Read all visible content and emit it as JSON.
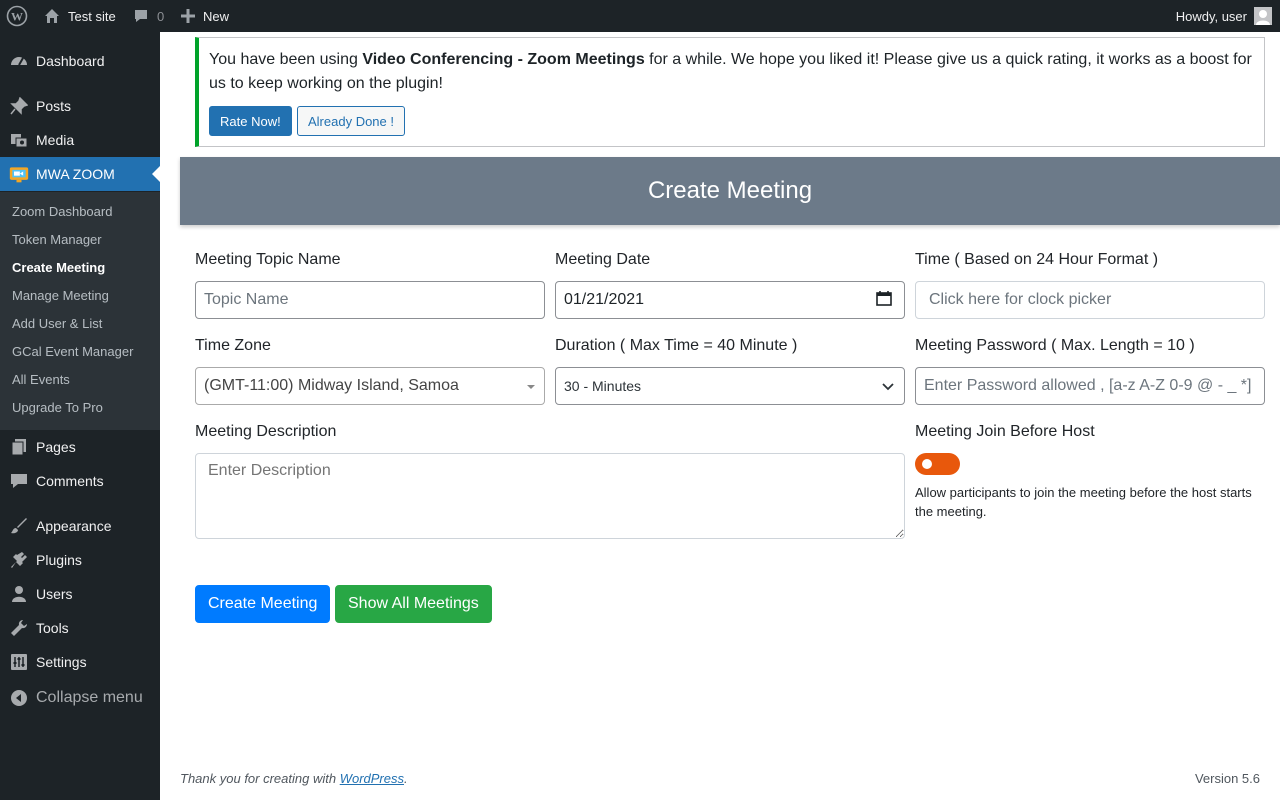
{
  "adminbar": {
    "site_name": "Test site",
    "comments_count": "0",
    "new_label": "New",
    "greeting": "Howdy, user"
  },
  "sidebar": {
    "menu": [
      {
        "label": "Dashboard",
        "icon": "dashboard-icon"
      },
      {
        "label": "Posts",
        "icon": "pin-icon"
      },
      {
        "label": "Media",
        "icon": "media-icon"
      },
      {
        "label": "MWA ZOOM",
        "icon": "video-camera-icon"
      },
      {
        "label": "Pages",
        "icon": "pages-icon"
      },
      {
        "label": "Comments",
        "icon": "comment-icon"
      },
      {
        "label": "Appearance",
        "icon": "paintbrush-icon"
      },
      {
        "label": "Plugins",
        "icon": "plug-icon"
      },
      {
        "label": "Users",
        "icon": "user-icon"
      },
      {
        "label": "Tools",
        "icon": "wrench-icon"
      },
      {
        "label": "Settings",
        "icon": "settings-icon"
      }
    ],
    "submenu": [
      "Zoom Dashboard",
      "Token Manager",
      "Create Meeting",
      "Manage Meeting",
      "Add User & List",
      "GCal Event Manager",
      "All Events",
      "Upgrade To Pro"
    ],
    "collapse_label": "Collapse menu"
  },
  "notice": {
    "text_before": "You have been using ",
    "plugin_name": "Video Conferencing - Zoom Meetings",
    "text_after": " for a while. We hope you liked it! Please give us a quick rating, it works as a boost for us to keep working on the plugin!",
    "rate_label": "Rate Now!",
    "done_label": "Already Done !"
  },
  "header": {
    "title": "Create Meeting"
  },
  "form": {
    "topic_label": "Meeting Topic Name",
    "topic_placeholder": "Topic Name",
    "date_label": "Meeting Date",
    "date_value": "01/21/2021",
    "time_label": "Time ( Based on 24 Hour Format )",
    "time_placeholder": "Click here for clock picker",
    "timezone_label": "Time Zone",
    "timezone_value": "(GMT-11:00) Midway Island, Samoa",
    "duration_label": "Duration ( Max Time = 40 Minute )",
    "duration_value": "30 - Minutes",
    "password_label": "Meeting Password ( Max. Length = 10 )",
    "password_placeholder": "Enter Password allowed , [a-z A-Z 0-9 @ - _ *]",
    "description_label": "Meeting Description",
    "description_placeholder": "Enter Description",
    "jbh_label": "Meeting Join Before Host",
    "jbh_help": "Allow participants to join the meeting before the host starts the meeting.",
    "create_label": "Create Meeting",
    "show_label": "Show All Meetings"
  },
  "footer": {
    "thanks_prefix": "Thank you for creating with ",
    "wordpress_link": "WordPress",
    "thanks_suffix": ".",
    "version": "Version 5.6"
  },
  "colors": {
    "admin_dark": "#1d2327",
    "accent_blue": "#2271b1",
    "header_grey": "#6c7a89",
    "toggle_orange": "#e8580c",
    "primary": "#007bff",
    "success": "#28a745"
  }
}
